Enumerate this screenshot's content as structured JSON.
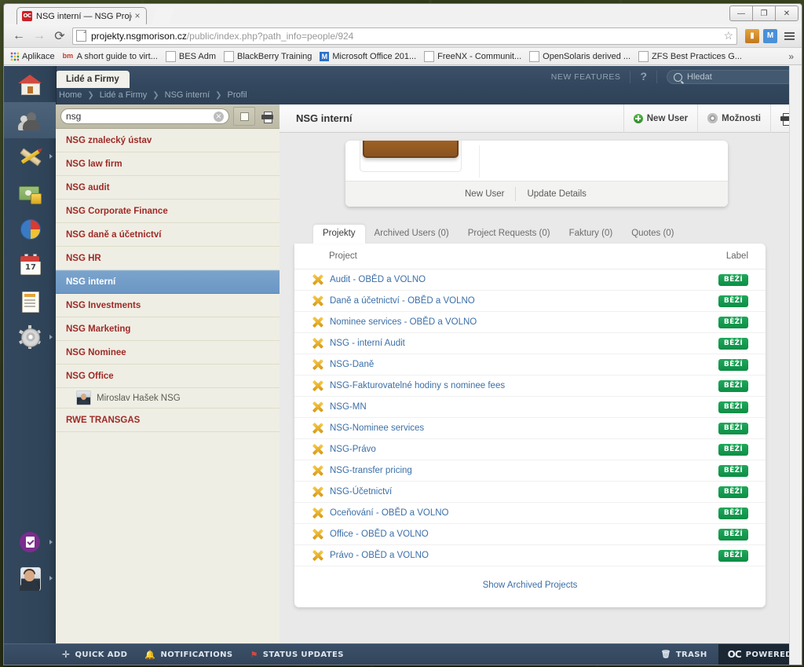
{
  "browser": {
    "tab": {
      "title": "NSG interní — NSG Projec",
      "favicon": "oc-favicon",
      "close": "×"
    },
    "url_host": "projekty.nsgmorison.cz",
    "url_path": "/public/index.php?path_info=people/924",
    "window_controls": {
      "minimize": "—",
      "maximize": "❐",
      "close": "✕"
    },
    "bookmarks": [
      {
        "label": "Aplikace",
        "icon": "apps-grid-icon"
      },
      {
        "label": "A short guide to virt...",
        "icon": "bm-red"
      },
      {
        "label": "BES Adm",
        "icon": "page-icon"
      },
      {
        "label": "BlackBerry Training",
        "icon": "page-icon"
      },
      {
        "label": "Microsoft Office 201...",
        "icon": "bm-blue"
      },
      {
        "label": "FreeNX - Communit...",
        "icon": "page-icon"
      },
      {
        "label": "OpenSolaris derived ...",
        "icon": "page-icon"
      },
      {
        "label": "ZFS Best Practices G...",
        "icon": "page-icon"
      }
    ],
    "bookmarks_overflow": "»"
  },
  "app": {
    "tab_label": "Lidé a Firmy",
    "breadcrumb": [
      "Home",
      "Lidé a Firmy",
      "NSG interní",
      "Profil"
    ],
    "new_features": "NEW FEATURES",
    "help": "?",
    "search_placeholder": "Hledat"
  },
  "rail": [
    {
      "name": "home-icon",
      "arrow": false
    },
    {
      "name": "people-icon",
      "arrow": false,
      "active": true
    },
    {
      "name": "tools-icon",
      "arrow": true
    },
    {
      "name": "money-icon",
      "arrow": false
    },
    {
      "name": "pie-chart-icon",
      "arrow": false
    },
    {
      "name": "calendar-icon",
      "arrow": false,
      "day": "17"
    },
    {
      "name": "document-icon",
      "arrow": false
    },
    {
      "name": "gear-icon",
      "arrow": true
    },
    {
      "name": "clipboard-icon",
      "arrow": true
    },
    {
      "name": "user-avatar-icon",
      "arrow": true
    }
  ],
  "sidebar": {
    "search_value": "nsg",
    "search_clear": "×",
    "companies": [
      {
        "label": "NSG znalecký ústav",
        "selected": false
      },
      {
        "label": "NSG law firm",
        "selected": false
      },
      {
        "label": "NSG audit",
        "selected": false
      },
      {
        "label": "NSG Corporate Finance",
        "selected": false
      },
      {
        "label": "NSG daně a účetnictví",
        "selected": false
      },
      {
        "label": "NSG HR",
        "selected": false
      },
      {
        "label": "NSG interní",
        "selected": true
      },
      {
        "label": "NSG Investments",
        "selected": false
      },
      {
        "label": "NSG Marketing",
        "selected": false
      },
      {
        "label": "NSG Nominee",
        "selected": false
      },
      {
        "label": "NSG Office",
        "selected": false
      }
    ],
    "person": "Miroslav Hašek NSG",
    "last_company": "RWE TRANSGAS"
  },
  "main": {
    "title": "NSG interní",
    "new_user_button": "New User",
    "options_button": "Možnosti",
    "card_actions": [
      "New User",
      "Update Details"
    ],
    "tabs": [
      {
        "label": "Projekty",
        "active": true
      },
      {
        "label": "Archived Users (0)",
        "active": false
      },
      {
        "label": "Project Requests (0)",
        "active": false
      },
      {
        "label": "Faktury (0)",
        "active": false
      },
      {
        "label": "Quotes (0)",
        "active": false
      }
    ],
    "columns": {
      "project": "Project",
      "label": "Label"
    },
    "projects": [
      {
        "name": "Audit - OBĚD a VOLNO",
        "status": "BĚŽÍ"
      },
      {
        "name": "Daně a účetnictví - OBĚD a VOLNO",
        "status": "BĚŽÍ"
      },
      {
        "name": "Nominee services - OBĚD a VOLNO",
        "status": "BĚŽÍ"
      },
      {
        "name": "NSG - interní Audit",
        "status": "BĚŽÍ"
      },
      {
        "name": "NSG-Daně",
        "status": "BĚŽÍ"
      },
      {
        "name": "NSG-Fakturovatelné hodiny s nominee fees",
        "status": "BĚŽÍ"
      },
      {
        "name": "NSG-MN",
        "status": "BĚŽÍ"
      },
      {
        "name": "NSG-Nominee services",
        "status": "BĚŽÍ"
      },
      {
        "name": "NSG-Právo",
        "status": "BĚŽÍ"
      },
      {
        "name": "NSG-transfer pricing",
        "status": "BĚŽÍ"
      },
      {
        "name": "NSG-Účetnictví",
        "status": "BĚŽÍ"
      },
      {
        "name": "Oceňování - OBĚD a VOLNO",
        "status": "BĚŽÍ"
      },
      {
        "name": "Office - OBĚD a VOLNO",
        "status": "BĚŽÍ"
      },
      {
        "name": "Právo - OBĚD a VOLNO",
        "status": "BĚŽÍ"
      }
    ],
    "show_archived": "Show Archived Projects"
  },
  "footer": {
    "quick_add": "QUICK ADD",
    "notifications": "NOTIFICATIONS",
    "status_updates": "STATUS UPDATES",
    "trash": "TRASH",
    "powered": "POWERED",
    "powered_logo": "OC"
  },
  "colors": {
    "accent_blue": "#33485e",
    "status_green": "#0d8e46",
    "company_red": "#9e2a26",
    "link_blue": "#3b6fa8",
    "selected_row": "#6c97c4"
  }
}
